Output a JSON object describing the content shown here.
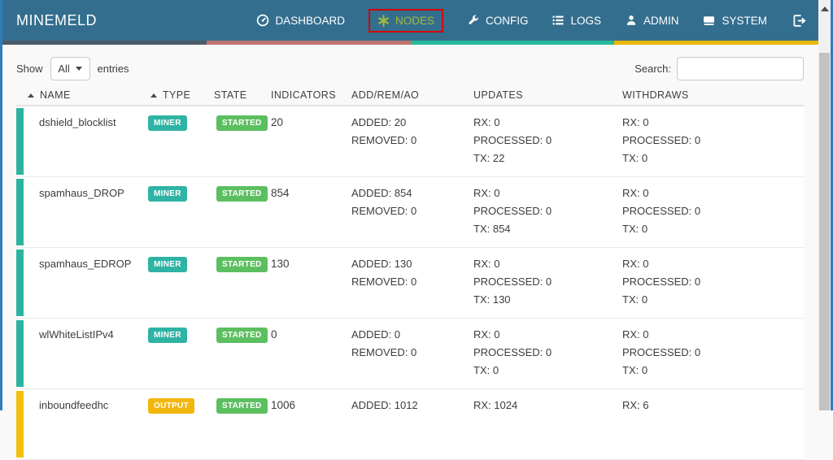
{
  "brand": "MINEMELD",
  "nav": {
    "items": [
      {
        "label": "DASHBOARD",
        "icon": "dashboard-icon",
        "active": false
      },
      {
        "label": "NODES",
        "icon": "nodes-icon",
        "active": true,
        "annotated": true
      },
      {
        "label": "CONFIG",
        "icon": "wrench-icon",
        "active": false
      },
      {
        "label": "LOGS",
        "icon": "list-icon",
        "active": false
      },
      {
        "label": "ADMIN",
        "icon": "user-icon",
        "active": false
      },
      {
        "label": "SYSTEM",
        "icon": "hard-drive-icon",
        "active": false
      }
    ],
    "logout_icon": "sign-out-icon"
  },
  "controls": {
    "show_label": "Show",
    "page_size_value": "All",
    "entries_label": "entries",
    "search_label": "Search:",
    "search_value": ""
  },
  "table": {
    "columns": [
      {
        "label": "NAME",
        "sorted": true
      },
      {
        "label": "TYPE",
        "sorted": true
      },
      {
        "label": "STATE",
        "sorted": false
      },
      {
        "label": "INDICATORS",
        "sorted": false
      },
      {
        "label": "ADD/REM/AO",
        "sorted": false
      },
      {
        "label": "UPDATES",
        "sorted": false
      },
      {
        "label": "WITHDRAWS",
        "sorted": false
      }
    ],
    "rows": [
      {
        "name": "dshield_blocklist",
        "type": "MINER",
        "state": "STARTED",
        "indicators": "20",
        "add_rem_ao": [
          "ADDED: 20",
          "REMOVED: 0"
        ],
        "updates": [
          "RX: 0",
          "PROCESSED: 0",
          "TX: 22"
        ],
        "withdraws": [
          "RX: 0",
          "PROCESSED: 0",
          "TX: 0"
        ]
      },
      {
        "name": "spamhaus_DROP",
        "type": "MINER",
        "state": "STARTED",
        "indicators": "854",
        "add_rem_ao": [
          "ADDED: 854",
          "REMOVED: 0"
        ],
        "updates": [
          "RX: 0",
          "PROCESSED: 0",
          "TX: 854"
        ],
        "withdraws": [
          "RX: 0",
          "PROCESSED: 0",
          "TX: 0"
        ]
      },
      {
        "name": "spamhaus_EDROP",
        "type": "MINER",
        "state": "STARTED",
        "indicators": "130",
        "add_rem_ao": [
          "ADDED: 130",
          "REMOVED: 0"
        ],
        "updates": [
          "RX: 0",
          "PROCESSED: 0",
          "TX: 130"
        ],
        "withdraws": [
          "RX: 0",
          "PROCESSED: 0",
          "TX: 0"
        ]
      },
      {
        "name": "wlWhiteListIPv4",
        "type": "MINER",
        "state": "STARTED",
        "indicators": "0",
        "add_rem_ao": [
          "ADDED: 0",
          "REMOVED: 0"
        ],
        "updates": [
          "RX: 0",
          "PROCESSED: 0",
          "TX: 0"
        ],
        "withdraws": [
          "RX: 0",
          "PROCESSED: 0",
          "TX: 0"
        ]
      },
      {
        "name": "inboundfeedhc",
        "type": "OUTPUT",
        "state": "STARTED",
        "indicators": "1006",
        "add_rem_ao": [
          "ADDED: 1012"
        ],
        "updates": [
          "RX: 1024"
        ],
        "withdraws": [
          "RX: 6"
        ]
      }
    ]
  },
  "colors": {
    "navbar_bg": "#346e8e",
    "nav_active": "#9fb83e",
    "annotation_red": "#d40000",
    "stripe": [
      "#4a5b68",
      "#c0736c",
      "#26b99a",
      "#e9b60c"
    ],
    "type_badge": {
      "miner": "#2fb3a4",
      "output": "#f2b70d"
    },
    "type_bar": {
      "miner": "#2cb3a0",
      "output": "#f2c00e"
    },
    "state_badge": {
      "started": "#5cbf5f"
    }
  }
}
